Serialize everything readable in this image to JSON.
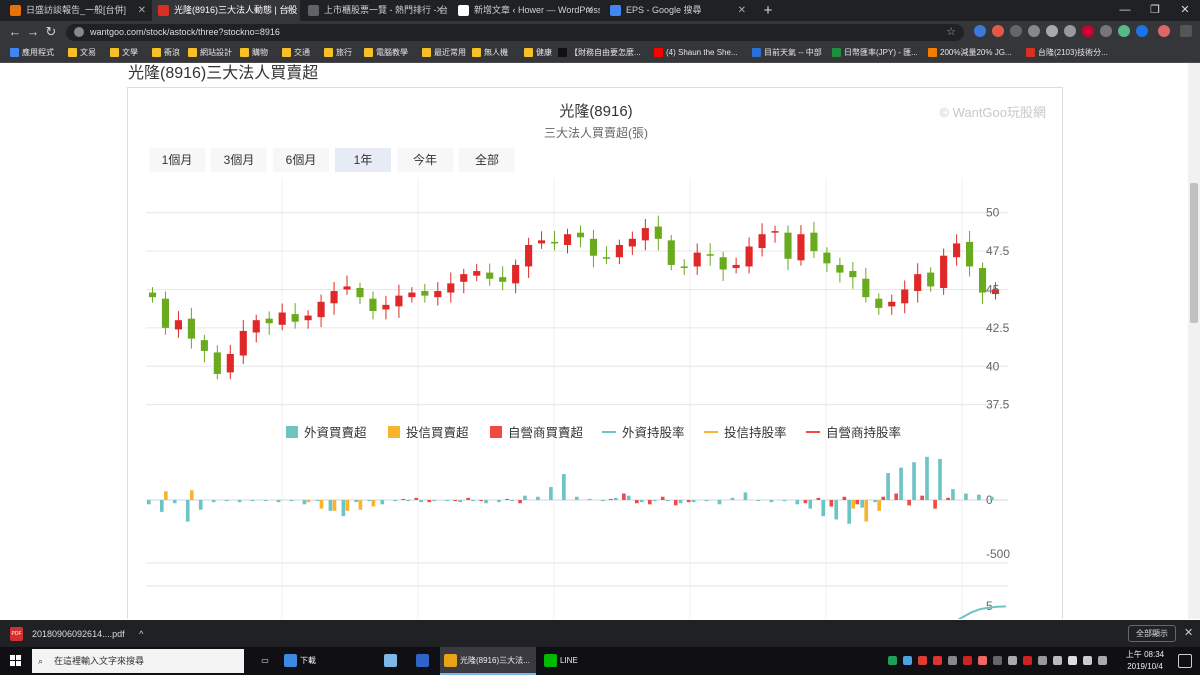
{
  "browser": {
    "tabs": [
      {
        "title": "日盛訪談報告_一般[台併]",
        "color": "#e8710a",
        "active": false
      },
      {
        "title": "光隆(8916)三大法人動態 | 台股 |",
        "color": "#d93025",
        "active": true
      },
      {
        "title": "上市櫃股票一覽 - 熱門排行 - 台",
        "color": "#5f6368",
        "active": false
      },
      {
        "title": "新增文章 ‹ Hower — WordPress",
        "color": "#ffffff",
        "active": false
      },
      {
        "title": "EPS - Google 搜尋",
        "color": "#4285f4",
        "active": false
      }
    ],
    "new_tab": "+",
    "window_controls": {
      "minimize": "—",
      "maximize": "❐",
      "close": "✕"
    },
    "url": "wantgoo.com/stock/astock/three?stockno=8916",
    "bookmarks": [
      {
        "label": "應用程式",
        "color": "#4285f4"
      },
      {
        "label": "文易",
        "color": "#f6c026"
      },
      {
        "label": "文學",
        "color": "#f6c026"
      },
      {
        "label": "衝浪",
        "color": "#f6c026"
      },
      {
        "label": "網站設計",
        "color": "#f6c026"
      },
      {
        "label": "購物",
        "color": "#f6c026"
      },
      {
        "label": "交通",
        "color": "#f6c026"
      },
      {
        "label": "旅行",
        "color": "#f6c026"
      },
      {
        "label": "電腦教學",
        "color": "#f6c026"
      },
      {
        "label": "最近常用",
        "color": "#f6c026"
      },
      {
        "label": "無人機",
        "color": "#f6c026"
      },
      {
        "label": "健康",
        "color": "#f6c026"
      },
      {
        "label": "【財務自由要怎麼...",
        "color": "#111111"
      },
      {
        "label": "(4) Shaun the She...",
        "color": "#ff0000"
      },
      {
        "label": "目前天氣 -- 中部",
        "color": "#2a6fd6"
      },
      {
        "label": "日幣匯率(JPY) - 匯...",
        "color": "#1e8e3e"
      },
      {
        "label": "200%減量20% JG...",
        "color": "#f57c00"
      },
      {
        "label": "台隆(2103)技術分...",
        "color": "#d93025"
      }
    ]
  },
  "page": {
    "heading": "光隆(8916)三大法人買賣超",
    "chart": {
      "title": "光隆(8916)",
      "subtitle": "三大法人買賣超(張)",
      "credits": "© WantGoo玩股網",
      "range_buttons": [
        "1個月",
        "3個月",
        "6個月",
        "1年",
        "今年",
        "全部"
      ],
      "range_selected": "1年",
      "legend": [
        {
          "label": "外資買賣超",
          "color": "#6cc4c4",
          "kind": "box"
        },
        {
          "label": "投信買賣超",
          "color": "#f7b42c",
          "kind": "box"
        },
        {
          "label": "自營商買賣超",
          "color": "#f24848",
          "kind": "box"
        },
        {
          "label": "外資持股率",
          "color": "#6cc4c4",
          "kind": "line"
        },
        {
          "label": "投信持股率",
          "color": "#f7b42c",
          "kind": "line"
        },
        {
          "label": "自營商持股率",
          "color": "#f24848",
          "kind": "line"
        }
      ]
    }
  },
  "chart_data": {
    "type": "candlestick",
    "price_axis": {
      "ticks": [
        37.5,
        40,
        42.5,
        45,
        47.5,
        50
      ],
      "ylim": [
        36.5,
        52
      ]
    },
    "candle_colors": {
      "up": "#e02828",
      "down": "#6aaa1e"
    },
    "close_prices": [
      44.5,
      42.5,
      43.0,
      41.8,
      41.0,
      39.5,
      40.8,
      42.3,
      43.0,
      42.8,
      43.5,
      42.9,
      43.3,
      44.2,
      44.9,
      45.2,
      44.5,
      43.6,
      44.0,
      44.6,
      44.8,
      44.6,
      44.9,
      45.4,
      46.0,
      46.2,
      45.7,
      45.5,
      46.6,
      47.9,
      48.2,
      48.0,
      48.6,
      48.4,
      47.2,
      47.0,
      47.9,
      48.3,
      49.0,
      48.3,
      46.6,
      46.4,
      47.4,
      47.2,
      46.3,
      46.6,
      47.8,
      48.6,
      48.8,
      47.0,
      48.6,
      47.5,
      46.7,
      46.1,
      45.8,
      44.5,
      43.8,
      44.2,
      45.0,
      46.0,
      45.2,
      47.2,
      48.0,
      46.5,
      44.8,
      45.0
    ],
    "institutional_net_axis": {
      "ticks": [
        0,
        -500
      ]
    },
    "foreign_net_buy": [
      -40,
      -110,
      -30,
      -200,
      -90,
      -20,
      -10,
      -20,
      -10,
      -10,
      -20,
      -10,
      -40,
      -10,
      -100,
      -150,
      -20,
      -10,
      -40,
      -10,
      -10,
      -20,
      -10,
      -10,
      -20,
      -10,
      -30,
      -20,
      -10,
      40,
      30,
      120,
      240,
      30,
      10,
      -10,
      20,
      40,
      -20,
      -10,
      -10,
      -30,
      -20,
      -10,
      -40,
      20,
      70,
      -10,
      -20,
      -10,
      -40,
      -80,
      -150,
      -180,
      -220,
      -70,
      -20,
      250,
      300,
      350,
      400,
      380,
      100,
      60,
      50,
      30
    ],
    "trust_net_buy": [
      0,
      80,
      0,
      90,
      0,
      0,
      0,
      0,
      0,
      0,
      0,
      0,
      -20,
      -80,
      -100,
      -100,
      -90,
      -60,
      0,
      0,
      0,
      0,
      0,
      0,
      0,
      0,
      0,
      0,
      0,
      0,
      0,
      0,
      0,
      0,
      0,
      0,
      0,
      0,
      0,
      0,
      0,
      0,
      0,
      0,
      0,
      0,
      0,
      0,
      0,
      0,
      0,
      0,
      0,
      0,
      -80,
      -200,
      -100,
      0,
      0,
      0,
      0,
      0,
      0,
      0,
      0,
      0
    ],
    "dealer_net_buy": [
      0,
      0,
      0,
      0,
      0,
      0,
      0,
      0,
      0,
      0,
      0,
      0,
      0,
      0,
      0,
      0,
      0,
      0,
      0,
      10,
      20,
      -20,
      0,
      -10,
      20,
      -10,
      0,
      10,
      -30,
      0,
      0,
      0,
      0,
      0,
      0,
      10,
      60,
      -30,
      -40,
      30,
      -50,
      -20,
      0,
      0,
      0,
      0,
      0,
      0,
      0,
      0,
      -30,
      20,
      -60,
      30,
      -40,
      0,
      30,
      60,
      -50,
      40,
      -80,
      20,
      0,
      0,
      0,
      0
    ],
    "holding_axis": {
      "ticks": [
        5
      ]
    },
    "foreign_holding_pct": [
      1.0,
      1.4,
      2.2,
      3.0,
      3.6,
      4.2,
      4.6,
      4.8,
      4.9,
      4.95
    ]
  },
  "taskbar": {
    "download_file": "20180906092614....pdf",
    "download_icon": "PDF",
    "show_all": "全部顯示",
    "search_placeholder": "在這裡輸入文字來搜尋",
    "items": [
      {
        "label": "下載",
        "color": "#3d8be0",
        "active": false
      },
      {
        "label": "",
        "color": "#7db7e8",
        "active": false
      },
      {
        "label": "",
        "color": "#2e63c8",
        "active": false
      },
      {
        "label": "光隆(8916)三大法...",
        "color": "#e8a317",
        "active": true
      },
      {
        "label": "LINE",
        "color": "#00b900",
        "active": false
      }
    ],
    "clock_period": "上午 08:34",
    "clock_date": "2019/10/4"
  }
}
